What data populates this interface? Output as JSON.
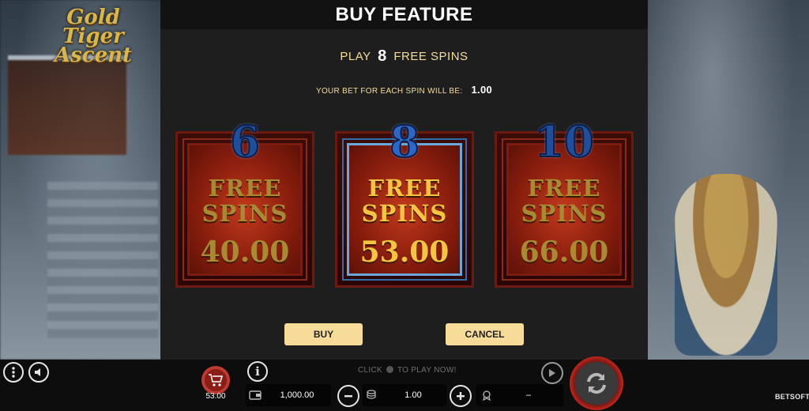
{
  "game": {
    "logo_text": "Gold Tiger Ascent"
  },
  "modal": {
    "title": "BUY FEATURE",
    "play_prefix": "PLAY",
    "play_count": "8",
    "play_suffix": "FREE SPINS",
    "bet_label": "YOUR BET FOR EACH SPIN WILL BE:",
    "bet_value": "1.00",
    "options": [
      {
        "spins": "6",
        "label_line1": "FREE",
        "label_line2": "SPINS",
        "price": "40.00",
        "selected": false
      },
      {
        "spins": "8",
        "label_line1": "FREE",
        "label_line2": "SPINS",
        "price": "53.00",
        "selected": true
      },
      {
        "spins": "10",
        "label_line1": "FREE",
        "label_line2": "SPINS",
        "price": "66.00",
        "selected": false
      }
    ],
    "buy_label": "BUY",
    "cancel_label": "CANCEL"
  },
  "bottom_bar": {
    "hint_prefix": "CLICK",
    "hint_suffix": "TO PLAY NOW!",
    "buy_feature_price": "53.00",
    "balance": "1,000.00",
    "bet": "1.00",
    "win": "–",
    "brand": "BETSOFT"
  },
  "icons": {
    "menu": "menu-dots-icon",
    "sound": "speaker-icon",
    "info": "info-icon",
    "cart": "cart-icon",
    "wallet": "wallet-icon",
    "coins": "coin-stack-icon",
    "minus": "minus-icon",
    "plus": "plus-icon",
    "win": "medal-icon",
    "autoplay": "play-icon",
    "spin": "refresh-icon"
  },
  "colors": {
    "accent": "#f6dc98",
    "gold": "#f5c542",
    "spin_red": "#c0241c"
  }
}
